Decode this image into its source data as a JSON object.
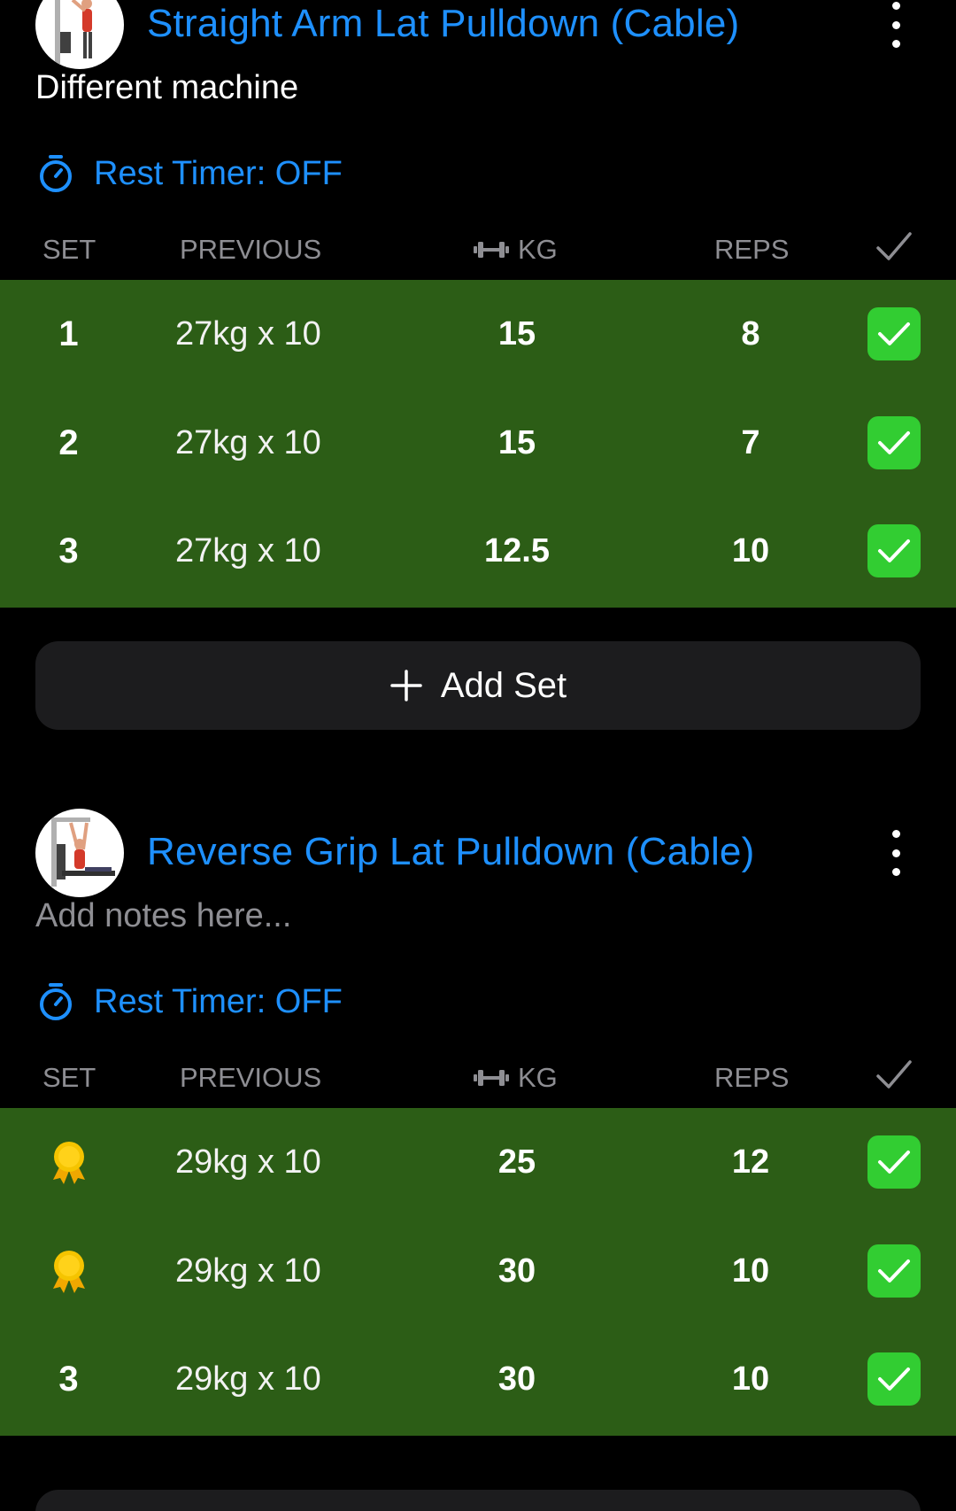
{
  "colors": {
    "background": "#000000",
    "accent_blue": "#1e90ff",
    "completed_row": "#2c5d16",
    "check_green": "#32cd32",
    "medal_gold": "#f5c400",
    "muted_text": "#8e8e93",
    "button_bg": "#1c1c1e"
  },
  "column_headers": {
    "set": "SET",
    "previous": "PREVIOUS",
    "kg": "KG",
    "reps": "REPS",
    "kg_icon": "dumbbell-icon",
    "done_icon": "checkmark-icon"
  },
  "exercises": [
    {
      "title": "Straight Arm Lat Pulldown (Cable)",
      "thumbnail": "cable-pulldown-illustration",
      "notes": "Different machine",
      "rest_timer": "Rest Timer: OFF",
      "add_set_label": "Add Set",
      "sets": [
        {
          "set": "1",
          "previous": "27kg x 10",
          "kg": "15",
          "reps": "8",
          "completed": true
        },
        {
          "set": "2",
          "previous": "27kg x 10",
          "kg": "15",
          "reps": "7",
          "completed": true
        },
        {
          "set": "3",
          "previous": "27kg x 10",
          "kg": "12.5",
          "reps": "10",
          "completed": true
        }
      ]
    },
    {
      "title": "Reverse Grip Lat Pulldown (Cable)",
      "thumbnail": "seated-pulldown-illustration",
      "notes_placeholder": "Add notes here...",
      "rest_timer": "Rest Timer: OFF",
      "sets": [
        {
          "set_icon": "medal-icon",
          "previous": "29kg x 10",
          "kg": "25",
          "reps": "12",
          "completed": true
        },
        {
          "set_icon": "medal-icon",
          "previous": "29kg x 10",
          "kg": "30",
          "reps": "10",
          "completed": true
        },
        {
          "set": "3",
          "previous": "29kg x 10",
          "kg": "30",
          "reps": "10",
          "completed": true
        }
      ]
    }
  ]
}
